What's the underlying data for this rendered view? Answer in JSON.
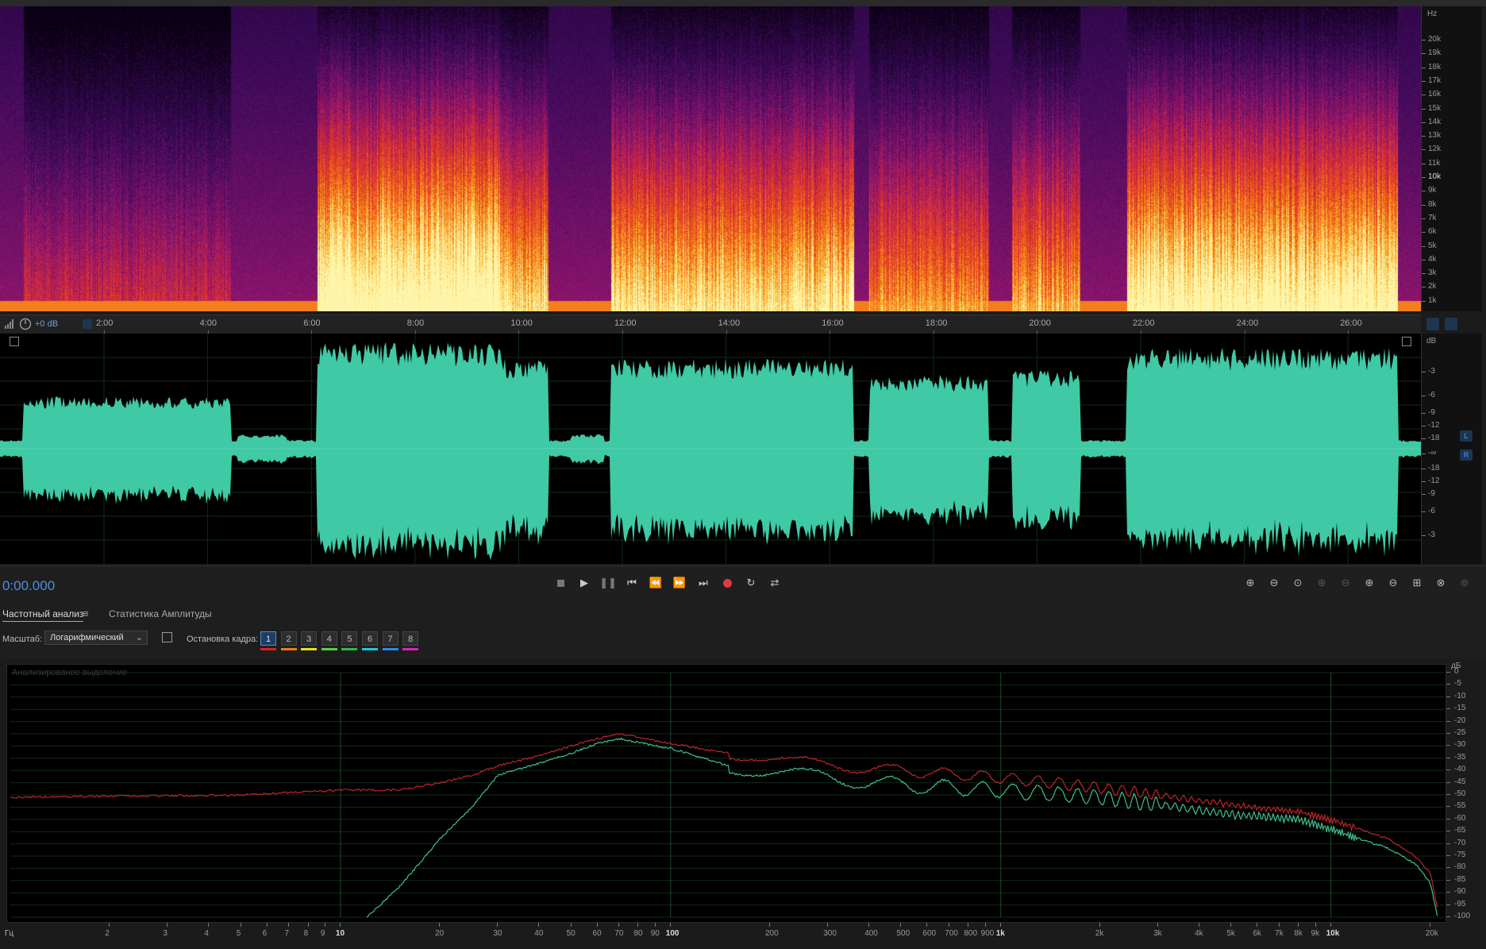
{
  "spectrogram": {
    "unit": "Hz",
    "ticks": [
      "20k",
      "19k",
      "18k",
      "17k",
      "16k",
      "15k",
      "14k",
      "13k",
      "12k",
      "11k",
      "10k",
      "9k",
      "8k",
      "7k",
      "6k",
      "5k",
      "4k",
      "3k",
      "2k",
      "1k"
    ]
  },
  "timeline": {
    "gain_label": "+0 dB",
    "labels": [
      "2:00",
      "4:00",
      "6:00",
      "8:00",
      "10:00",
      "12:00",
      "14:00",
      "16:00",
      "18:00",
      "20:00",
      "22:00",
      "24:00",
      "26:00"
    ]
  },
  "waveform": {
    "unit": "dB",
    "ticks": [
      "-3",
      "-6",
      "-9",
      "-12",
      "-18",
      "-∞",
      "-18",
      "-12",
      "-9",
      "-6",
      "-3"
    ],
    "channel_labels": [
      "L",
      "R"
    ],
    "color": "#3fc9a5"
  },
  "transport": {
    "time": "0:00.000"
  },
  "panel": {
    "tabs": [
      "Частотный анализ",
      "Статистика Амплитуды"
    ],
    "scale_label": "Масштаб:",
    "scale_value": "Логарифмический",
    "freeze_label": "Остановка кадра:",
    "frames": [
      "1",
      "2",
      "3",
      "4",
      "5",
      "6",
      "7",
      "8"
    ],
    "frame_colors": [
      "#e02020",
      "#f07a1a",
      "#e8e020",
      "#5ad040",
      "#2fb84a",
      "#20c8d8",
      "#2a8cf0",
      "#e020c0"
    ],
    "analyzed_label": "Анализированое выделение"
  },
  "freq_chart": {
    "db_unit": "дБ",
    "db_ticks": [
      "0",
      "-5",
      "-10",
      "-15",
      "-20",
      "-25",
      "-30",
      "-35",
      "-40",
      "-45",
      "-50",
      "-55",
      "-60",
      "-65",
      "-70",
      "-75",
      "-80",
      "-85",
      "-90",
      "-95",
      "-100"
    ],
    "x_unit": "Гц",
    "x_labels": [
      "2",
      "3",
      "4",
      "5",
      "6",
      "7",
      "8",
      "9",
      "10",
      "20",
      "30",
      "40",
      "50",
      "60",
      "70",
      "80",
      "90",
      "100",
      "200",
      "300",
      "400",
      "500",
      "600",
      "700",
      "800",
      "900",
      "1k",
      "2k",
      "3k",
      "4k",
      "5k",
      "6k",
      "7k",
      "8k",
      "9k",
      "10k",
      "20k"
    ]
  },
  "chart_data": {
    "type": "line",
    "title": "",
    "xlabel": "Гц",
    "ylabel": "дБ",
    "xscale": "log",
    "xlim": [
      1,
      22000
    ],
    "ylim": [
      -100,
      0
    ],
    "x": [
      1,
      5,
      10,
      12,
      15,
      20,
      25,
      30,
      40,
      50,
      60,
      70,
      100,
      150,
      200,
      300,
      500,
      1000,
      2000,
      3000,
      5000,
      8000,
      10000,
      15000,
      18000,
      20000,
      21000
    ],
    "series": [
      {
        "color": "#c0242a",
        "values": [
          -51,
          -50,
          -48,
          -48,
          -48,
          -45,
          -42,
          -38,
          -34,
          -30,
          -27,
          -25,
          -29,
          -33,
          -35,
          -38,
          -40,
          -43,
          -47,
          -50,
          -54,
          -57,
          -60,
          -68,
          -75,
          -82,
          -96
        ]
      },
      {
        "color": "#3fbf8f",
        "values": [
          null,
          null,
          null,
          -100,
          -88,
          -68,
          -55,
          -42,
          -37,
          -33,
          -29,
          -27,
          -31,
          -38,
          -41,
          -43,
          -46,
          -48,
          -51,
          -54,
          -58,
          -60,
          -64,
          -72,
          -78,
          -86,
          -99
        ]
      }
    ]
  }
}
